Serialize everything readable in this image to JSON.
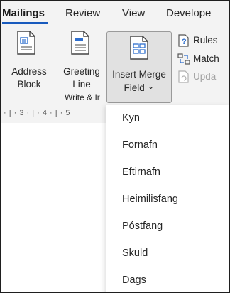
{
  "tabs": [
    {
      "label": "Mailings",
      "active": true
    },
    {
      "label": "Review",
      "active": false
    },
    {
      "label": "View",
      "active": false
    },
    {
      "label": "Develope",
      "active": false
    }
  ],
  "ribbon": {
    "address_block": {
      "line1": "Address",
      "line2": "Block"
    },
    "greeting_line": {
      "line1": "Greeting",
      "line2": "Line"
    },
    "insert_merge_field": {
      "line1": "Insert Merge",
      "line2": "Field",
      "chevron": "⌄"
    },
    "rules": "Rules",
    "match_fields": "Match",
    "update_labels": "Upda",
    "group_label": "Write & Ir"
  },
  "ruler": {
    "text": "· | · 3 · | · 4 · | · 5"
  },
  "merge_fields": [
    "Kyn",
    "Fornafn",
    "Eftirnafn",
    "Heimilisfang",
    "Póstfang",
    "Skuld",
    "Dags"
  ],
  "colors": {
    "accent": "#185abd",
    "ribbon_bg": "#f3f3f3",
    "pressed_bg": "#e1e1e1"
  }
}
